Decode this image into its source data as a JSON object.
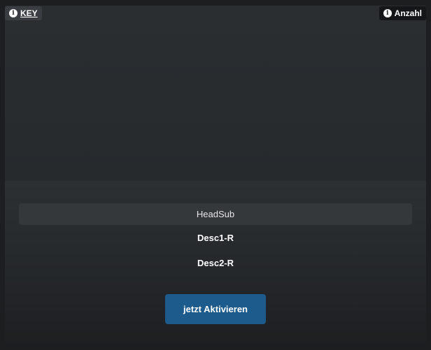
{
  "badges": {
    "key_label": "KEY",
    "count_label": "Anzahl",
    "info_glyph": "i"
  },
  "content": {
    "headsub": "HeadSub",
    "desc1": "Desc1-R",
    "desc2": "Desc2-R"
  },
  "actions": {
    "activate_label": "jetzt Aktivieren"
  },
  "colors": {
    "button": "#1c5b8c",
    "card_background": "#25292c",
    "headsub_background": "#34383b"
  },
  "icons": {
    "key_icon": "info-icon",
    "count_icon": "info-icon"
  }
}
